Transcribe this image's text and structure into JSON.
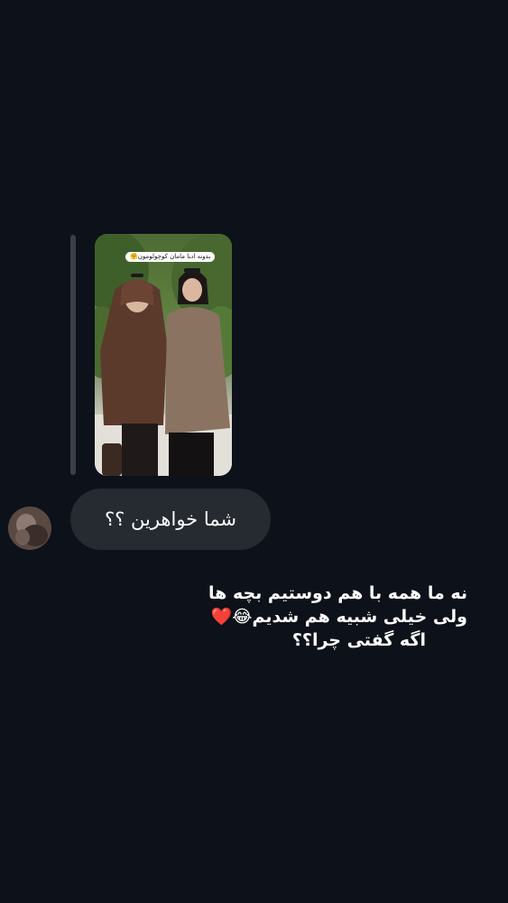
{
  "thread": {
    "story_reply": {
      "caption": "بدونه ادبا مامان کوچولومون🤗"
    },
    "incoming_message": {
      "text": "شما خواهرین ؟؟"
    },
    "overlay_text": {
      "line1": "نه ما همه با هم دوستیم بچه ها",
      "line2": "ولی خیلی شبیه هم شدیم😂❤️",
      "line3": "اگه گفتی چرا؟؟"
    }
  },
  "colors": {
    "background": "#0d1119",
    "bubble": "#262a31",
    "reply_bar": "#3a3f48",
    "text": "#ffffff"
  }
}
